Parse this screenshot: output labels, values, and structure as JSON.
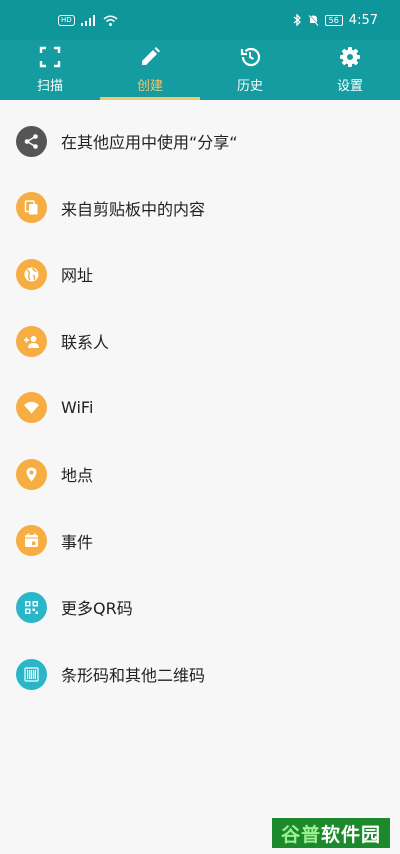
{
  "status_bar": {
    "hd_badge": "HD",
    "battery": "56",
    "time": "4:57"
  },
  "tabs": [
    {
      "label": "扫描",
      "icon": "scan-icon",
      "active": false
    },
    {
      "label": "创建",
      "icon": "pencil-icon",
      "active": true
    },
    {
      "label": "历史",
      "icon": "history-icon",
      "active": false
    },
    {
      "label": "设置",
      "icon": "gear-icon",
      "active": false
    }
  ],
  "colors": {
    "status_bar": "#0f969b",
    "tab_bar": "#159ca0",
    "active_tab": "#f5c36a",
    "icon_dark": "#555555",
    "icon_orange": "#f6ad42",
    "icon_teal": "#29b6c9"
  },
  "items": [
    {
      "label": "在其他应用中使用“分享“",
      "icon": "share-icon",
      "color": "#555555"
    },
    {
      "label": "来自剪贴板中的内容",
      "icon": "clipboard-icon",
      "color": "#f6ad42"
    },
    {
      "label": "网址",
      "icon": "globe-icon",
      "color": "#f6ad42"
    },
    {
      "label": "联系人",
      "icon": "add-contact-icon",
      "color": "#f6ad42"
    },
    {
      "label": "WiFi",
      "icon": "wifi-icon",
      "color": "#f6ad42"
    },
    {
      "label": "地点",
      "icon": "location-pin-icon",
      "color": "#f6ad42"
    },
    {
      "label": "事件",
      "icon": "calendar-icon",
      "color": "#f6ad42"
    },
    {
      "label": "更多QR码",
      "icon": "qr-code-icon",
      "color": "#29b6c9"
    },
    {
      "label": "条形码和其他二维码",
      "icon": "barcode-icon",
      "color": "#29b6c9"
    }
  ],
  "watermark": {
    "left": "谷普",
    "right": "软件园"
  }
}
